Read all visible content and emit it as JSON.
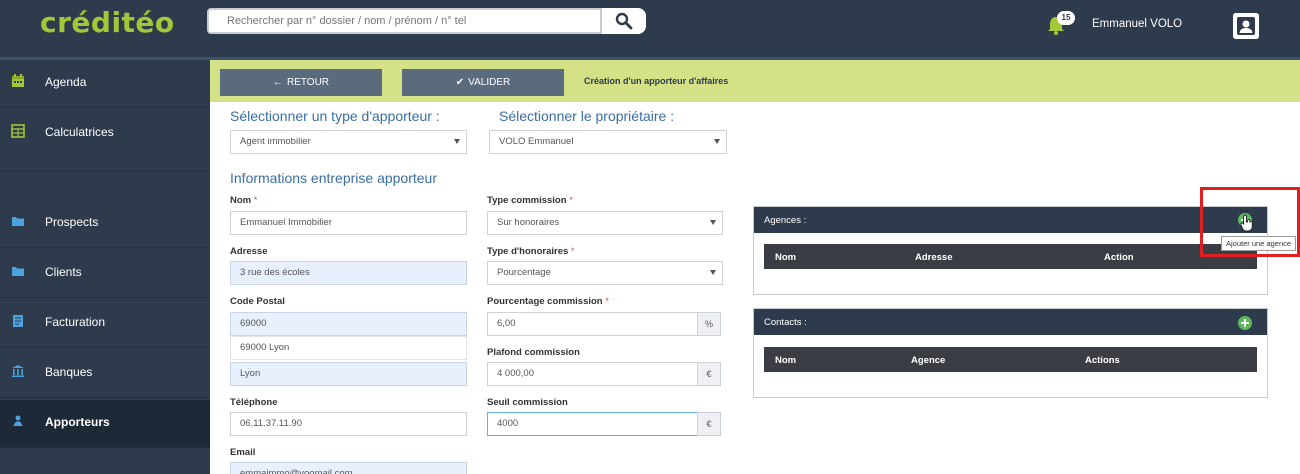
{
  "app": {
    "logo": "créditéo",
    "search_placeholder": "Rechercher par n° dossier / nom / prénom / n° tel",
    "notifications_count": "15",
    "user_name": "Emmanuel VOLO"
  },
  "sidebar": {
    "items": [
      {
        "label": "Agenda",
        "icon": "calendar-icon"
      },
      {
        "label": "Calculatrices",
        "icon": "calculator-icon"
      },
      {
        "label": "Prospects",
        "icon": "folder-icon"
      },
      {
        "label": "Clients",
        "icon": "folder-icon"
      },
      {
        "label": "Facturation",
        "icon": "invoice-icon"
      },
      {
        "label": "Banques",
        "icon": "bank-icon"
      },
      {
        "label": "Apporteurs",
        "icon": "handshake-icon",
        "active": true
      }
    ]
  },
  "actions": {
    "back_label": "RETOUR",
    "validate_label": "VALIDER",
    "page_title": "Création d'un apporteur d'affaires"
  },
  "form": {
    "type_apporteur_label": "Sélectionner un type d'apporteur :",
    "type_apporteur_value": "Agent immobilier",
    "proprietaire_label": "Sélectionner le propriétaire :",
    "proprietaire_value": "VOLO Emmanuel",
    "section_title": "Informations entreprise apporteur",
    "nom_label": "Nom",
    "nom_value": "Emmanuel Immobilier",
    "adresse_label": "Adresse",
    "adresse_value": "3 rue des écoles",
    "code_postal_label": "Code Postal",
    "code_postal_value": "69000",
    "city_suggestion": "69000 Lyon",
    "ville_value": "Lyon",
    "telephone_label": "Téléphone",
    "telephone_value": "06.11.37.11.90",
    "email_label": "Email",
    "email_value": "emmaimmo@yoomail.com",
    "type_commission_label": "Type commission",
    "type_commission_value": "Sur honoraires",
    "type_honoraires_label": "Type d'honoraires",
    "type_honoraires_value": "Pourcentage",
    "pourcentage_label": "Pourcentage commission",
    "pourcentage_value": "6,00",
    "pourcentage_unit": "%",
    "plafond_label": "Plafond commission",
    "plafond_value": "4 000,00",
    "plafond_unit": "€",
    "seuil_label": "Seuil commission",
    "seuil_value": "4000",
    "seuil_unit": "€",
    "required_mark": "*"
  },
  "agences_panel": {
    "title": "Agences :",
    "columns": [
      "Nom",
      "Adresse",
      "Action"
    ],
    "add_tooltip": "Ajouter une agence"
  },
  "contacts_panel": {
    "title": "Contacts :",
    "columns": [
      "Nom",
      "Agence",
      "Actions"
    ]
  },
  "colors": {
    "nav_bg": "#2e3b4c",
    "accent_green": "#a4c639",
    "action_bar": "#d4e186",
    "title_blue": "#3b6ea5",
    "highlight_red": "#e02020"
  }
}
